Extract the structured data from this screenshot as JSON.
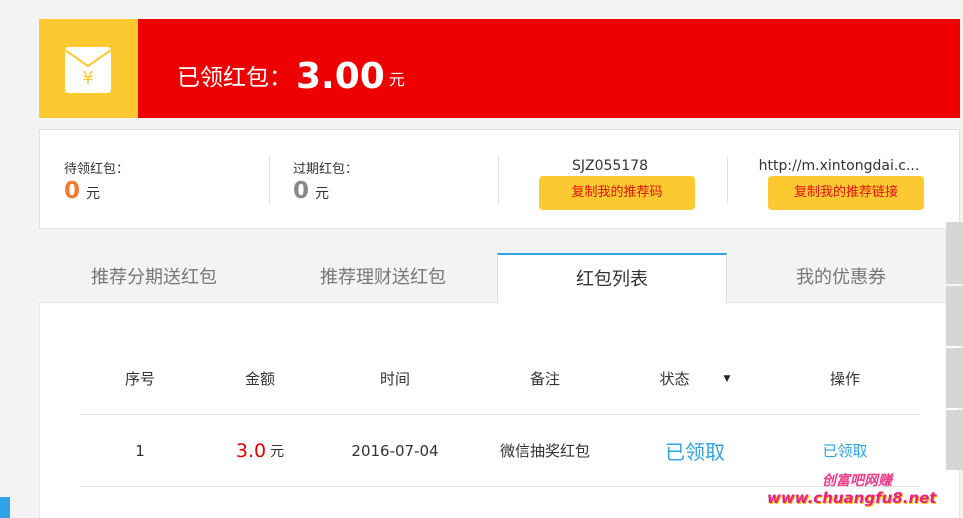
{
  "banner": {
    "label": "已领红包：",
    "amount": "3.00",
    "unit": "元"
  },
  "stats": {
    "pending_label": "待领红包：",
    "pending_value": "0",
    "pending_unit": "元",
    "expired_label": "过期红包：",
    "expired_value": "0",
    "expired_unit": "元",
    "referral_code": "SJZ055178",
    "copy_code_label": "复制我的推荐码",
    "referral_link": "http://m.xintongdai.c...",
    "copy_link_label": "复制我的推荐链接"
  },
  "tabs": [
    {
      "label": "推荐分期送红包"
    },
    {
      "label": "推荐理财送红包"
    },
    {
      "label": "红包列表"
    },
    {
      "label": "我的优惠券"
    }
  ],
  "active_tab": "红包列表",
  "table": {
    "headers": [
      "序号",
      "金额",
      "时间",
      "备注",
      "状态",
      "操作"
    ],
    "status_caret": "▼",
    "rows": [
      {
        "index": "1",
        "amount": "3.0",
        "unit": "元",
        "time": "2016-07-04",
        "note": "微信抽奖红包",
        "status": "已领取",
        "action": "已领取"
      }
    ]
  },
  "watermark": {
    "cn": "创富吧网赚",
    "url": "www.chuangfu8.net"
  },
  "colors": {
    "banner_red": "#ef0000",
    "accent_yellow": "#fdc931",
    "link_blue": "#2fa3e6",
    "amount_red": "#e60000"
  }
}
